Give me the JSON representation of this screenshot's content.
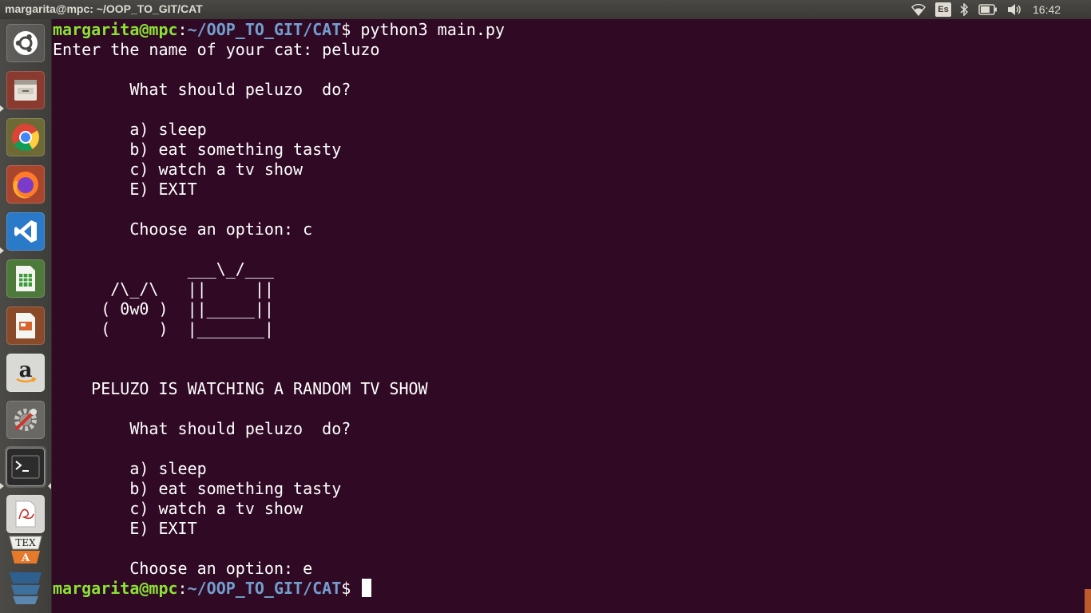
{
  "window": {
    "title": "margarita@mpc: ~/OOP_TO_GIT/CAT"
  },
  "panel": {
    "keyboard_layout": "Es",
    "clock": "16:42",
    "indicators": [
      "wifi-icon",
      "keyboard-layout-indicator",
      "bluetooth-icon",
      "battery-icon",
      "volume-icon"
    ]
  },
  "launcher": {
    "items": [
      {
        "name": "ubuntu-dash-icon"
      },
      {
        "name": "files-icon"
      },
      {
        "name": "chrome-icon"
      },
      {
        "name": "firefox-icon"
      },
      {
        "name": "vscode-icon"
      },
      {
        "name": "libreoffice-calc-icon"
      },
      {
        "name": "libreoffice-impress-icon"
      },
      {
        "name": "amazon-icon"
      },
      {
        "name": "system-settings-icon"
      },
      {
        "name": "terminal-icon"
      },
      {
        "name": "document-viewer-icon"
      },
      {
        "name": "texstudio-icon"
      },
      {
        "name": "workspace-switcher-icon"
      }
    ]
  },
  "terminal": {
    "prompt_user": "margarita@mpc",
    "prompt_sep": ":",
    "prompt_path": "~/OOP_TO_GIT/CAT",
    "prompt_end": "$ ",
    "command": "python3 main.py",
    "lines": [
      "Enter the name of your cat: peluzo",
      "",
      "        What should peluzo  do?",
      "",
      "        a) sleep",
      "        b) eat something tasty",
      "        c) watch a tv show",
      "        E) EXIT",
      "",
      "        Choose an option: c",
      "",
      "              ___\\_/___",
      "      /\\_/\\   ||     ||",
      "     ( 0w0 )  ||_____||",
      "     (     )  |_______|",
      "",
      "",
      "    PELUZO IS WATCHING A RANDOM TV SHOW",
      "",
      "        What should peluzo  do?",
      "",
      "        a) sleep",
      "        b) eat something tasty",
      "        c) watch a tv show",
      "        E) EXIT",
      "",
      "        Choose an option: e"
    ],
    "final_prompt_command": ""
  },
  "colors": {
    "terminal_bg": "#300a24",
    "prompt_user": "#8ae234",
    "prompt_path": "#729fcf",
    "panel_bg": "#3c3b37"
  }
}
